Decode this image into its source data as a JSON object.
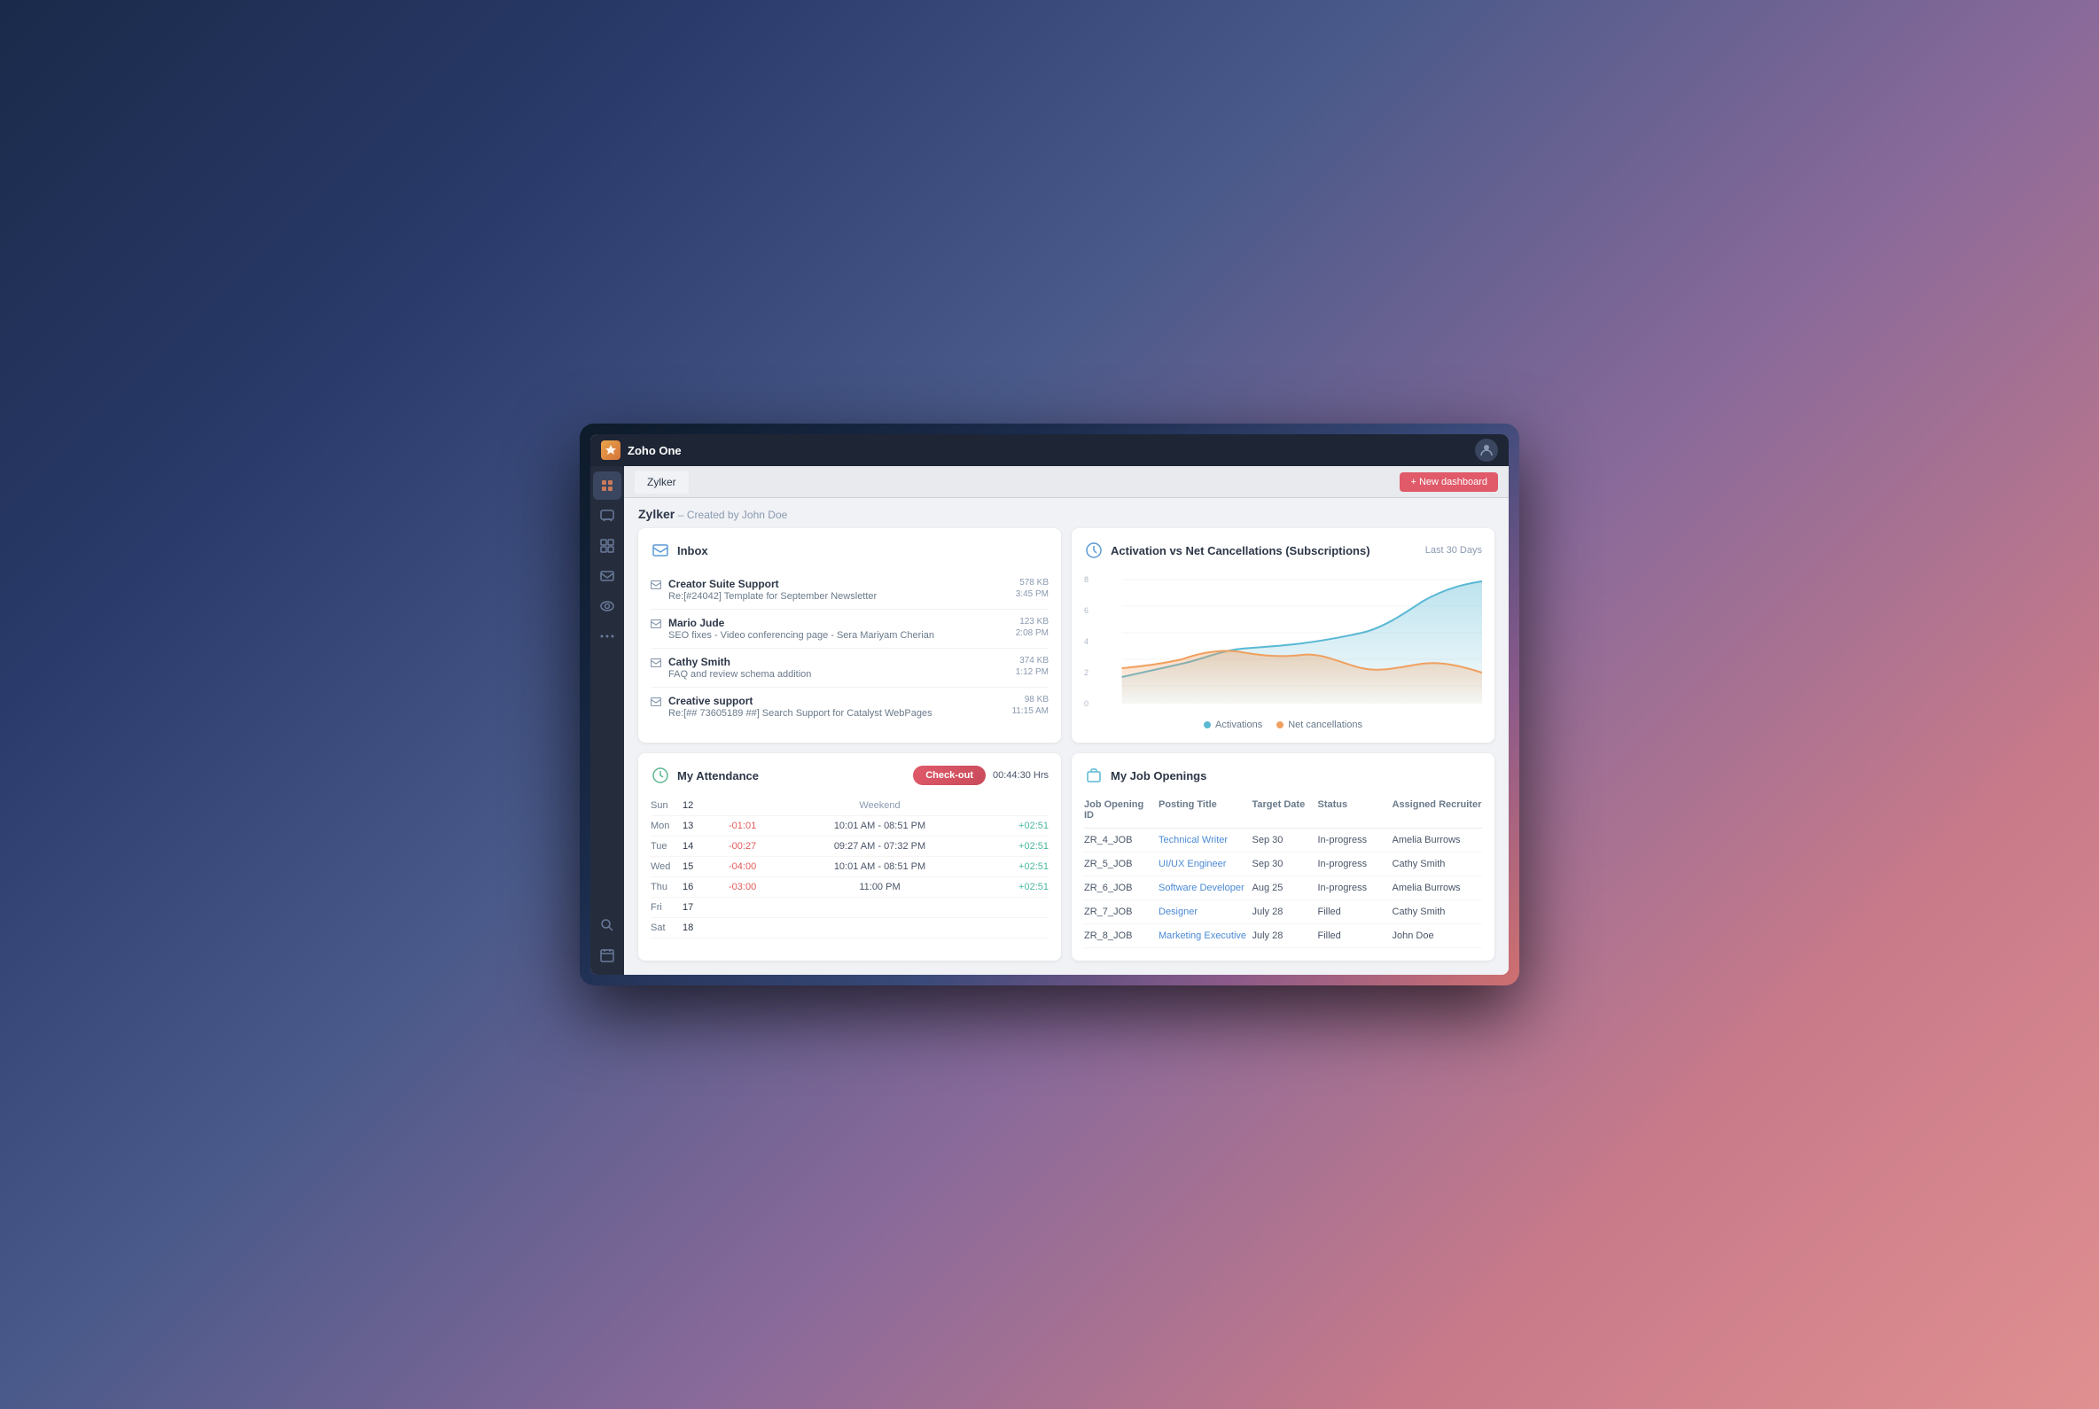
{
  "app": {
    "title": "Zoho One",
    "logo_unicode": "❋"
  },
  "tab_bar": {
    "active_tab": "Zylker",
    "new_dashboard_label": "+ New dashboard"
  },
  "page": {
    "title": "Zylker",
    "subtitle": "– Created by John Doe"
  },
  "inbox_widget": {
    "title": "Inbox",
    "icon": "✉",
    "items": [
      {
        "sender": "Creator Suite Support",
        "subject": "Re:[#24042] Template for September Newsletter",
        "size": "578 KB",
        "time": "3:45 PM"
      },
      {
        "sender": "Mario Jude",
        "subject": "SEO fixes - Video conferencing page - Sera Mariyam Cherian",
        "size": "123 KB",
        "time": "2:08 PM"
      },
      {
        "sender": "Cathy Smith",
        "subject": "FAQ and review schema addition",
        "size": "374 KB",
        "time": "1:12 PM"
      },
      {
        "sender": "Creative support",
        "subject": "Re:[## 73605189 ##] Search Support for Catalyst WebPages",
        "size": "98 KB",
        "time": "11:15 AM"
      }
    ]
  },
  "chart_widget": {
    "title": "Activation vs Net Cancellations (Subscriptions)",
    "period": "Last 30 Days",
    "icon": "🔔",
    "legend": {
      "activations_label": "Activations",
      "cancellations_label": "Net cancellations",
      "activations_color": "#5ab8d4",
      "cancellations_color": "#f0a060"
    },
    "y_labels": [
      "8",
      "6",
      "4",
      "2",
      "0"
    ]
  },
  "attendance_widget": {
    "title": "My Attendance",
    "icon": "🕐",
    "checkout_label": "Check-out",
    "duration": "00:44:30 Hrs",
    "rows": [
      {
        "day": "Sun",
        "date": "12",
        "deficit": "",
        "time_range": "Weekend",
        "extra": ""
      },
      {
        "day": "Mon",
        "date": "13",
        "deficit": "-01:01",
        "time_range": "10:01 AM - 08:51 PM",
        "extra": "+02:51"
      },
      {
        "day": "Tue",
        "date": "14",
        "deficit": "-00:27",
        "time_range": "09:27 AM - 07:32 PM",
        "extra": "+02:51"
      },
      {
        "day": "Wed",
        "date": "15",
        "deficit": "-04:00",
        "time_range": "10:01 AM - 08:51 PM",
        "extra": "+02:51"
      },
      {
        "day": "Thu",
        "date": "16",
        "deficit": "-03:00",
        "time_range": "11:00 PM",
        "extra": "+02:51"
      },
      {
        "day": "Fri",
        "date": "17",
        "deficit": "",
        "time_range": "",
        "extra": ""
      },
      {
        "day": "Sat",
        "date": "18",
        "deficit": "",
        "time_range": "",
        "extra": ""
      }
    ]
  },
  "jobs_widget": {
    "title": "My Job Openings",
    "icon": "💼",
    "columns": [
      "Job Opening ID",
      "Posting Title",
      "Target Date",
      "Status",
      "Assigned Recruiter"
    ],
    "rows": [
      {
        "id": "ZR_4_JOB",
        "title": "Technical Writer",
        "date": "Sep 30",
        "status": "In-progress",
        "recruiter": "Amelia Burrows"
      },
      {
        "id": "ZR_5_JOB",
        "title": "UI/UX Engineer",
        "date": "Sep 30",
        "status": "In-progress",
        "recruiter": "Cathy Smith"
      },
      {
        "id": "ZR_6_JOB",
        "title": "Software Developer",
        "date": "Aug 25",
        "status": "In-progress",
        "recruiter": "Amelia Burrows"
      },
      {
        "id": "ZR_7_JOB",
        "title": "Designer",
        "date": "July 28",
        "status": "Filled",
        "recruiter": "Cathy Smith"
      },
      {
        "id": "ZR_8_JOB",
        "title": "Marketing Executive",
        "date": "July 28",
        "status": "Filled",
        "recruiter": "John Doe"
      }
    ]
  },
  "sidebar": {
    "items": [
      {
        "icon": "⊞",
        "name": "home"
      },
      {
        "icon": "💬",
        "name": "messages"
      },
      {
        "icon": "📊",
        "name": "analytics"
      },
      {
        "icon": "📧",
        "name": "mail"
      },
      {
        "icon": "🔍",
        "name": "search2"
      },
      {
        "icon": "⋯",
        "name": "more"
      },
      {
        "icon": "🔍",
        "name": "search3"
      },
      {
        "icon": "📅",
        "name": "calendar"
      }
    ]
  }
}
